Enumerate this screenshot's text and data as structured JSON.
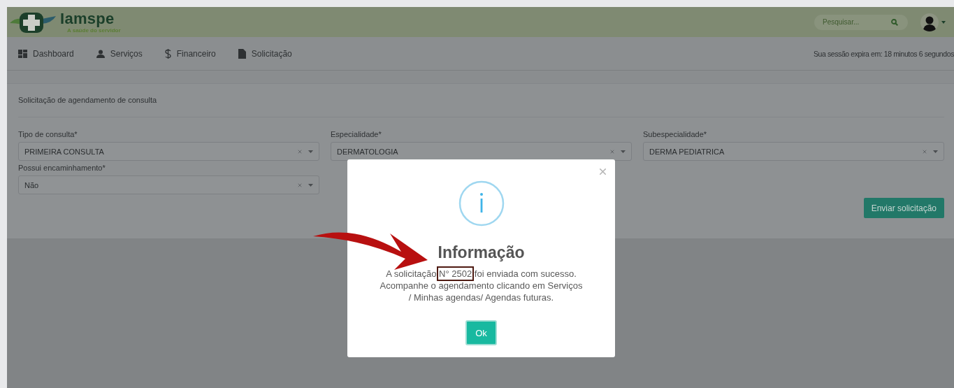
{
  "header": {
    "logo_title": "Iamspe",
    "logo_subtitle": "A saúde do servidor",
    "search": {
      "placeholder": "Pesquisar..."
    }
  },
  "nav": {
    "items": [
      {
        "label": "Dashboard"
      },
      {
        "label": "Serviços"
      },
      {
        "label": "Financeiro"
      },
      {
        "label": "Solicitação"
      }
    ],
    "session": "Sua sessão expira em: 18 minutos 6 segundos"
  },
  "card": {
    "title": "Solicitação de agendamento de consulta",
    "fields": [
      {
        "label": "Tipo de consulta*",
        "value": "PRIMEIRA CONSULTA"
      },
      {
        "label": "Especialidade*",
        "value": "DERMATOLOGIA"
      },
      {
        "label": "Subespecialidade*",
        "value": "DERMA PEDIATRICA"
      },
      {
        "label": "Possui encaminhamento*",
        "value": "Não"
      }
    ],
    "submit": "Enviar solicitação"
  },
  "modal": {
    "title": "Informação",
    "message": {
      "before": "A solicitação",
      "highlight": "N° 2502",
      "after": "foi enviada com sucesso. Acompanhe o agendamento clicando em Serviços / Minhas agendas/ Agendas futuras."
    },
    "ok": "Ok"
  }
}
